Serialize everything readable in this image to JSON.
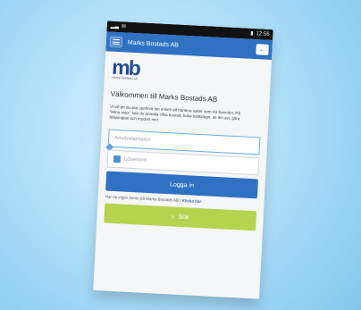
{
  "status_bar": {
    "left_icons": [
      "signal-icon",
      "mail-icon"
    ],
    "right_text": "12:56"
  },
  "app_bar": {
    "title": "Marks Bostads AB"
  },
  "brand": {
    "logo_text": "mb",
    "logo_subtext": "marks bostads ab"
  },
  "content": {
    "welcome_title": "Välkommen till Marks Bostads AB",
    "welcome_text": "Vi vill att du ska uppleva det enkelt att hantera saker som rör boendet. På \"Mina sidor\" kan du anmäla vilka bostad, boka tvättstugn, se din avi, göra felanmälan och mycket mer."
  },
  "form": {
    "username_placeholder": "Användarnamn",
    "password_placeholder": "Lösenord",
    "login_label": "Logga in"
  },
  "signup": {
    "prompt": "Har du ingen konto på Marks Bostads AB?",
    "link_label": "Klicka här"
  },
  "search": {
    "label": "Sök",
    "icon": "search-icon"
  },
  "colors": {
    "primary": "#2f72c4",
    "accent": "#b6d24f",
    "background": "#b8e3fb"
  }
}
